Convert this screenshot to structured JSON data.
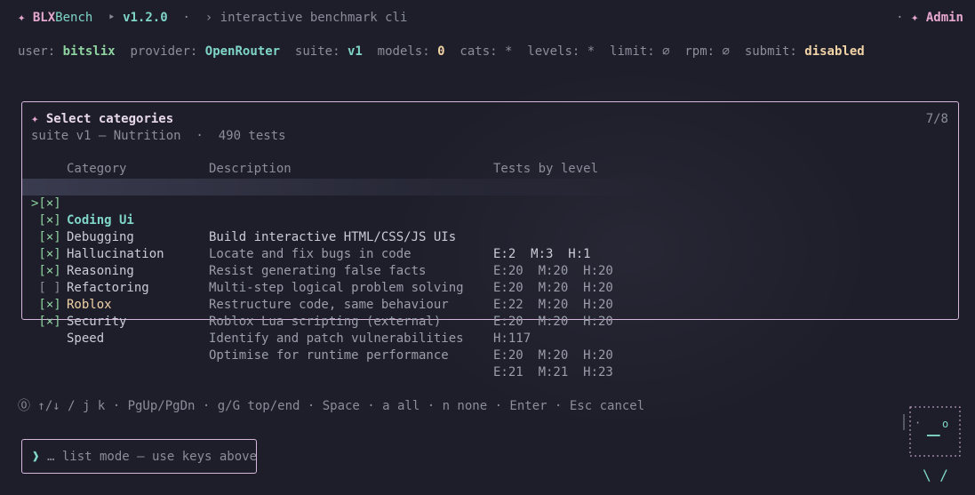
{
  "app": {
    "star": "✦",
    "name_a": "BLX",
    "name_b": "Bench",
    "arrow": "‣",
    "version": "v1.2.0",
    "sep": "·",
    "chev": "›",
    "tagline": "interactive benchmark cli",
    "admin_sep": "·",
    "admin_star": "✦",
    "admin_label": "Admin"
  },
  "status": {
    "user_label": "user:",
    "user": "bitslix",
    "provider_label": "provider:",
    "provider": "OpenRouter",
    "suite_label": "suite:",
    "suite": "v1",
    "models_label": "models:",
    "models": "0",
    "cats_label": "cats:",
    "cats": "*",
    "levels_label": "levels:",
    "levels": "*",
    "limit_label": "limit:",
    "limit": "∅",
    "rpm_label": "rpm:",
    "rpm": "∅",
    "submit_label": "submit:",
    "submit": "disabled"
  },
  "panel": {
    "star": "✦",
    "title": "Select categories",
    "count": "7/8",
    "subtitle": "suite v1 — Nutrition  ·  490 tests",
    "headers": {
      "category": "Category",
      "description": "Description",
      "levels": "Tests by level"
    },
    "rows": [
      {
        "sel": ">[×]",
        "category": "Coding Ui",
        "description": "Build interactive HTML/CSS/JS UIs",
        "levels": "E:2  M:3  H:1"
      },
      {
        "sel": " [×]",
        "category": "Debugging",
        "description": "Locate and fix bugs in code",
        "levels": "E:20  M:20  H:20"
      },
      {
        "sel": " [×]",
        "category": "Hallucination",
        "description": "Resist generating false facts",
        "levels": "E:20  M:20  H:20"
      },
      {
        "sel": " [×]",
        "category": "Reasoning",
        "description": "Multi-step logical problem solving",
        "levels": "E:22  M:20  H:20"
      },
      {
        "sel": " [×]",
        "category": "Refactoring",
        "description": "Restructure code, same behaviour",
        "levels": "E:20  M:20  H:20"
      },
      {
        "sel": " [ ]",
        "category": "Roblox",
        "description": "Roblox Lua scripting (external)",
        "levels": "H:117"
      },
      {
        "sel": " [×]",
        "category": "Security",
        "description": "Identify and patch vulnerabilities",
        "levels": "E:20  M:20  H:20"
      },
      {
        "sel": " [×]",
        "category": "Speed",
        "description": "Optimise for runtime performance",
        "levels": "E:21  M:21  H:23"
      }
    ]
  },
  "keys": "⓪ ↑/↓ / j k · PgUp/PgDn · g/G top/end · Space · a all · n none · Enter · Esc cancel",
  "input": {
    "caret": "❱",
    "text": "… list mode — use keys above"
  },
  "mascot": {
    "eye": "·",
    "mouth": "▁▁",
    "o": "o",
    "legs": "\\ /"
  },
  "colors": {
    "background": "#1e1e2a",
    "accent_pink": "#e7a8d0",
    "accent_teal": "#7fd6c8",
    "accent_green": "#8fd3a0",
    "accent_cream": "#f1d3a6",
    "border": "#d7b7dc"
  }
}
